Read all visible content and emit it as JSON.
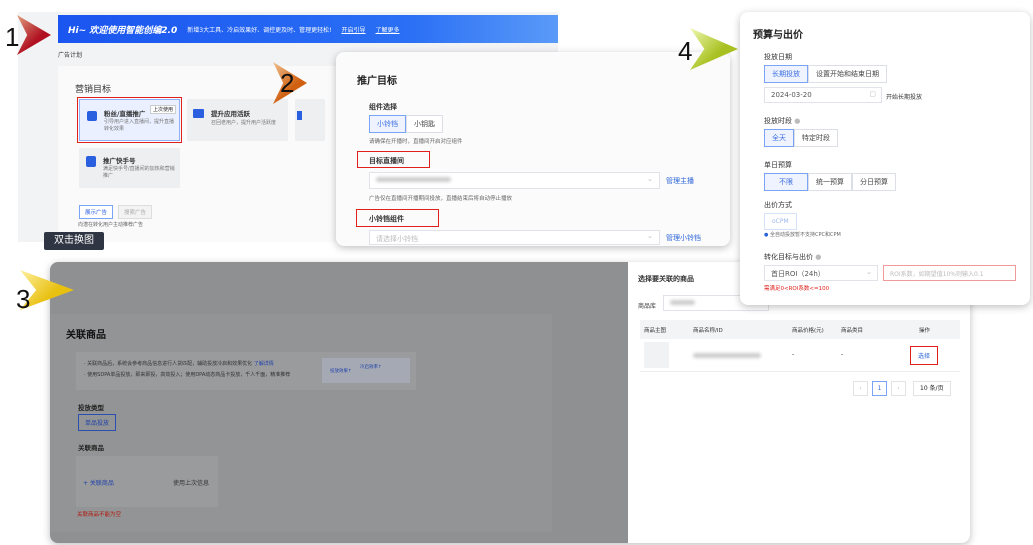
{
  "steps": [
    "1",
    "2",
    "3",
    "4"
  ],
  "panel1": {
    "banner_title": "Hi~ 欢迎使用智能创编2.0",
    "banner_desc": "新增3大工具、冷启效果好、调控更及时、管理更轻松!",
    "banner_link1": "开启引导",
    "banner_link2": "了解更多",
    "breadcrumb": "广告计划",
    "section_title": "营销目标",
    "cards": [
      {
        "title": "粉丝/直播推广",
        "desc": "引导用户进入直播间，提升直播转化效果",
        "badge": "上次使用"
      },
      {
        "title": "提升应用活跃",
        "desc": "召回老用户，提升用户活跃度"
      },
      {
        "title": "推广快手号",
        "desc": "满足快手号/直播间的加热和营销推广"
      }
    ],
    "ad_types": [
      "展示广告",
      "搜索广告"
    ],
    "ad_type_hint": "向潜在转化用户主动推荐广告",
    "swap_tag": "双击换图"
  },
  "panel2": {
    "title": "推广目标",
    "component_label": "组件选择",
    "component_options": [
      "小铃铛",
      "小钥匙"
    ],
    "component_hint": "请确保在开播时，直播间开启对应组件",
    "live_label": "目标直播间",
    "live_hint": "广告仅在直播间开播期间投放，直播结束后将自动停止播放",
    "manage_live": "管理主播",
    "bell_label": "小铃铛组件",
    "bell_placeholder": "请选择小铃铛",
    "manage_bell": "管理小铃铛"
  },
  "panel3": {
    "title": "关联商品",
    "tip1": "· 关联商品后，系统会参考商品信息进行人货匹配，辅助投放冷启和效果优化",
    "tip_link": "了解详情",
    "tip2": "· 使用SDPA单品投放，即来即投，高效投入；使用DPA动态商品卡投放，千人千面，精准推荐",
    "banner_a": "投放效果↑",
    "banner_b": "冷启效率↑",
    "type_label": "投放类型",
    "type_value": "单品投放",
    "product_label": "关联商品",
    "add_product": "+ 关联商品",
    "use_last": "使用上次信息",
    "error": "关联商品不能为空"
  },
  "drawer": {
    "title": "选择要关联的商品",
    "library_label": "商品库",
    "columns": [
      "商品主图",
      "商品名称/ID",
      "商品价格(元)",
      "商品类目",
      "操作"
    ],
    "rows": [
      {
        "price": "-",
        "category": "-",
        "action": "选择"
      }
    ],
    "page": "1",
    "page_size": "10 条/页"
  },
  "panel4": {
    "title": "预算与出价",
    "date_label": "投放日期",
    "date_options": [
      "长期投放",
      "设置开始和结束日期"
    ],
    "date_value": "2024-03-20",
    "date_hint": "开始长期投放",
    "period_label": "投放时段",
    "period_options": [
      "全天",
      "特定时段"
    ],
    "budget_label": "单日预算",
    "budget_options": [
      "不限",
      "统一预算",
      "分日预算"
    ],
    "bid_label": "出价方式",
    "bid_value": "oCPM",
    "bid_info": "全自动投放暂不支持CPC和CPM",
    "goal_label": "转化目标与出价",
    "goal_value": "首日ROI（24h）",
    "roi_placeholder": "ROI系数，如期望值10%则输入0.1",
    "roi_error": "需满足0<ROI系数<=100"
  },
  "colors": {
    "primary": "#3a6de0",
    "banner": "#1f5cf0",
    "error": "#e0201a"
  }
}
